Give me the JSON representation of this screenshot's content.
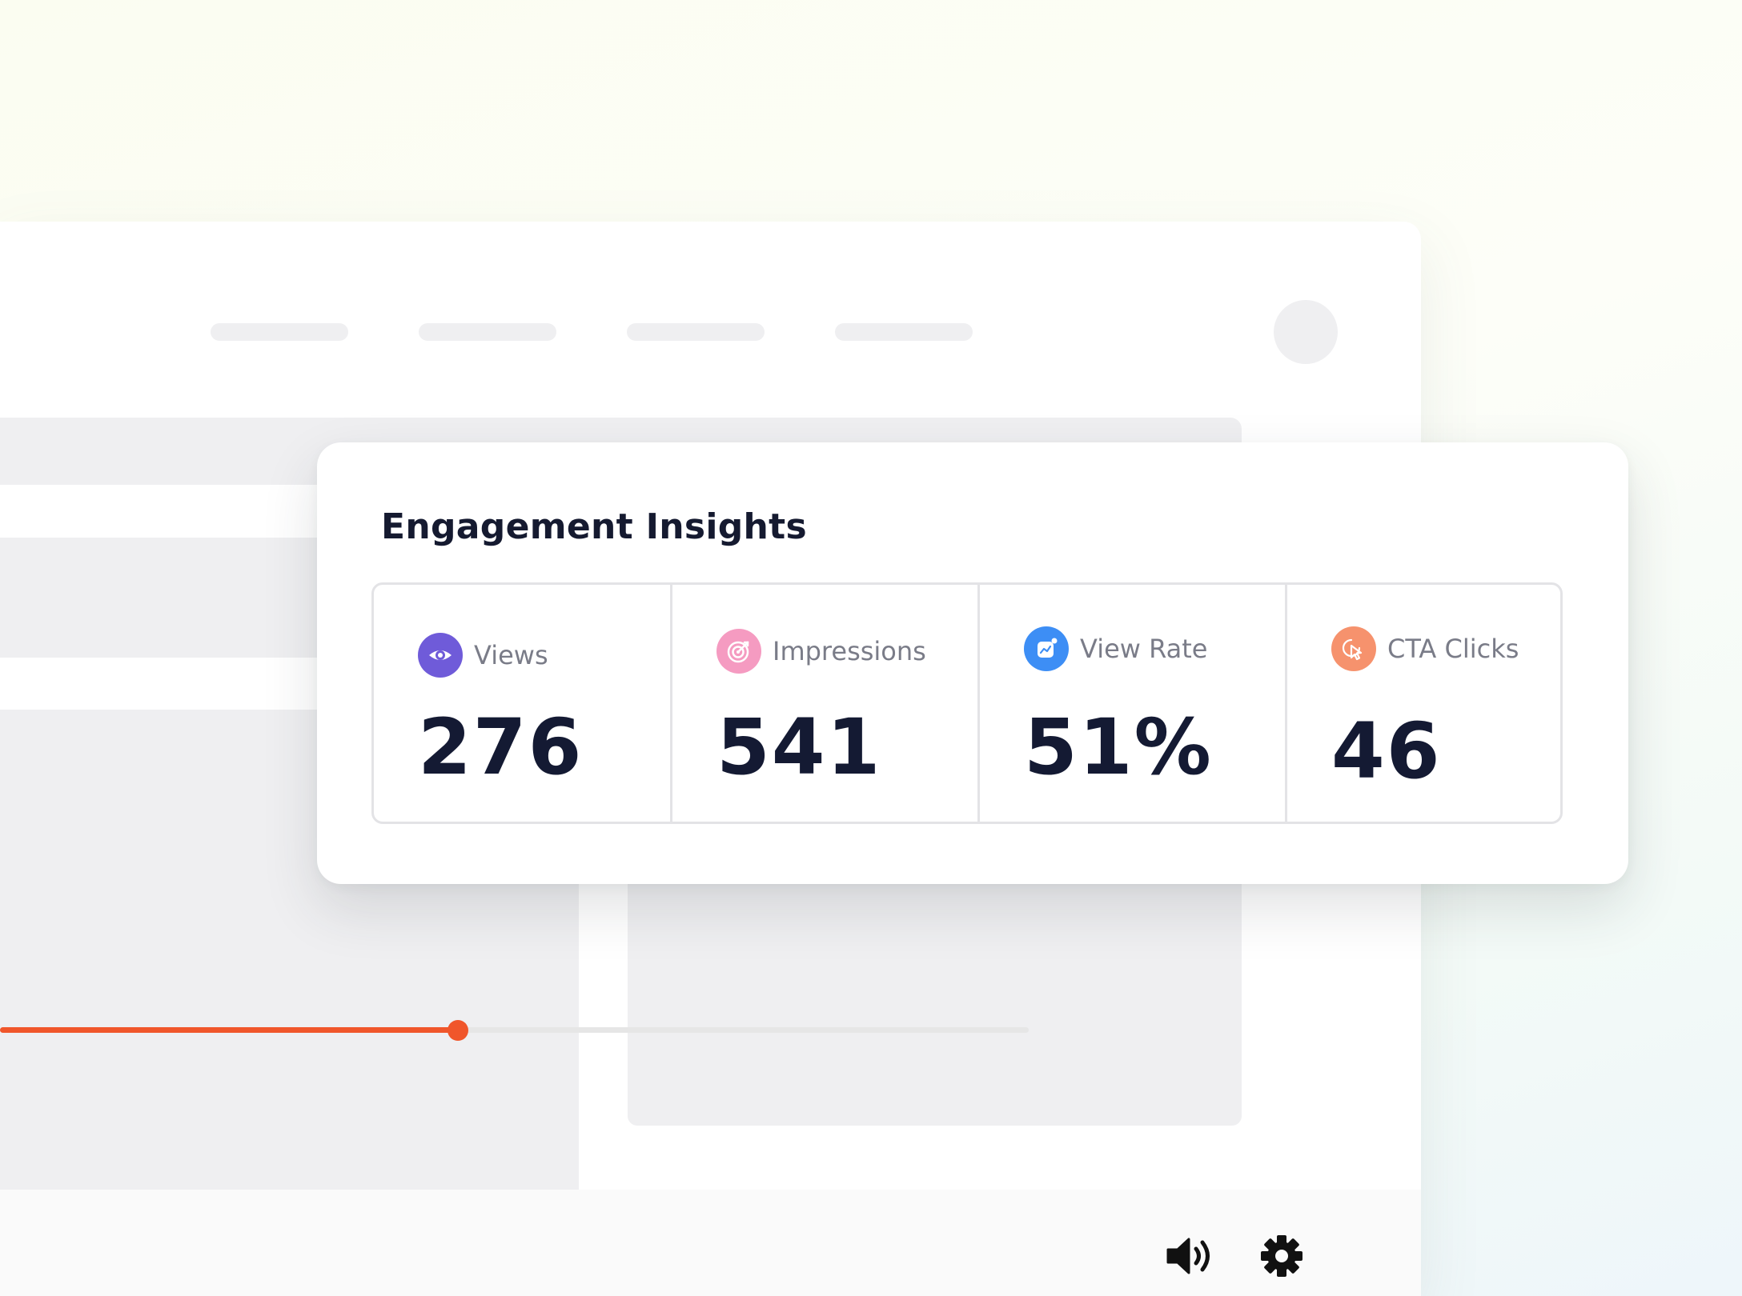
{
  "window": {
    "nav_items": [
      "",
      "",
      "",
      ""
    ]
  },
  "insights": {
    "title": "Engagement Insights",
    "metrics": [
      {
        "label": "Views",
        "value": "276",
        "icon": "eye-icon",
        "color": "#6f5bd9"
      },
      {
        "label": "Impressions",
        "value": "541",
        "icon": "target-icon",
        "color": "#f59bc1"
      },
      {
        "label": "View Rate",
        "value": "51%",
        "icon": "view-rate-icon",
        "color": "#3d8ef5"
      },
      {
        "label": "CTA Clicks",
        "value": "46",
        "icon": "cursor-click-icon",
        "color": "#f6926d"
      }
    ]
  },
  "player": {
    "progress": 0.445,
    "accent": "#f0562b",
    "controls": [
      "volume-icon",
      "gear-icon"
    ]
  }
}
